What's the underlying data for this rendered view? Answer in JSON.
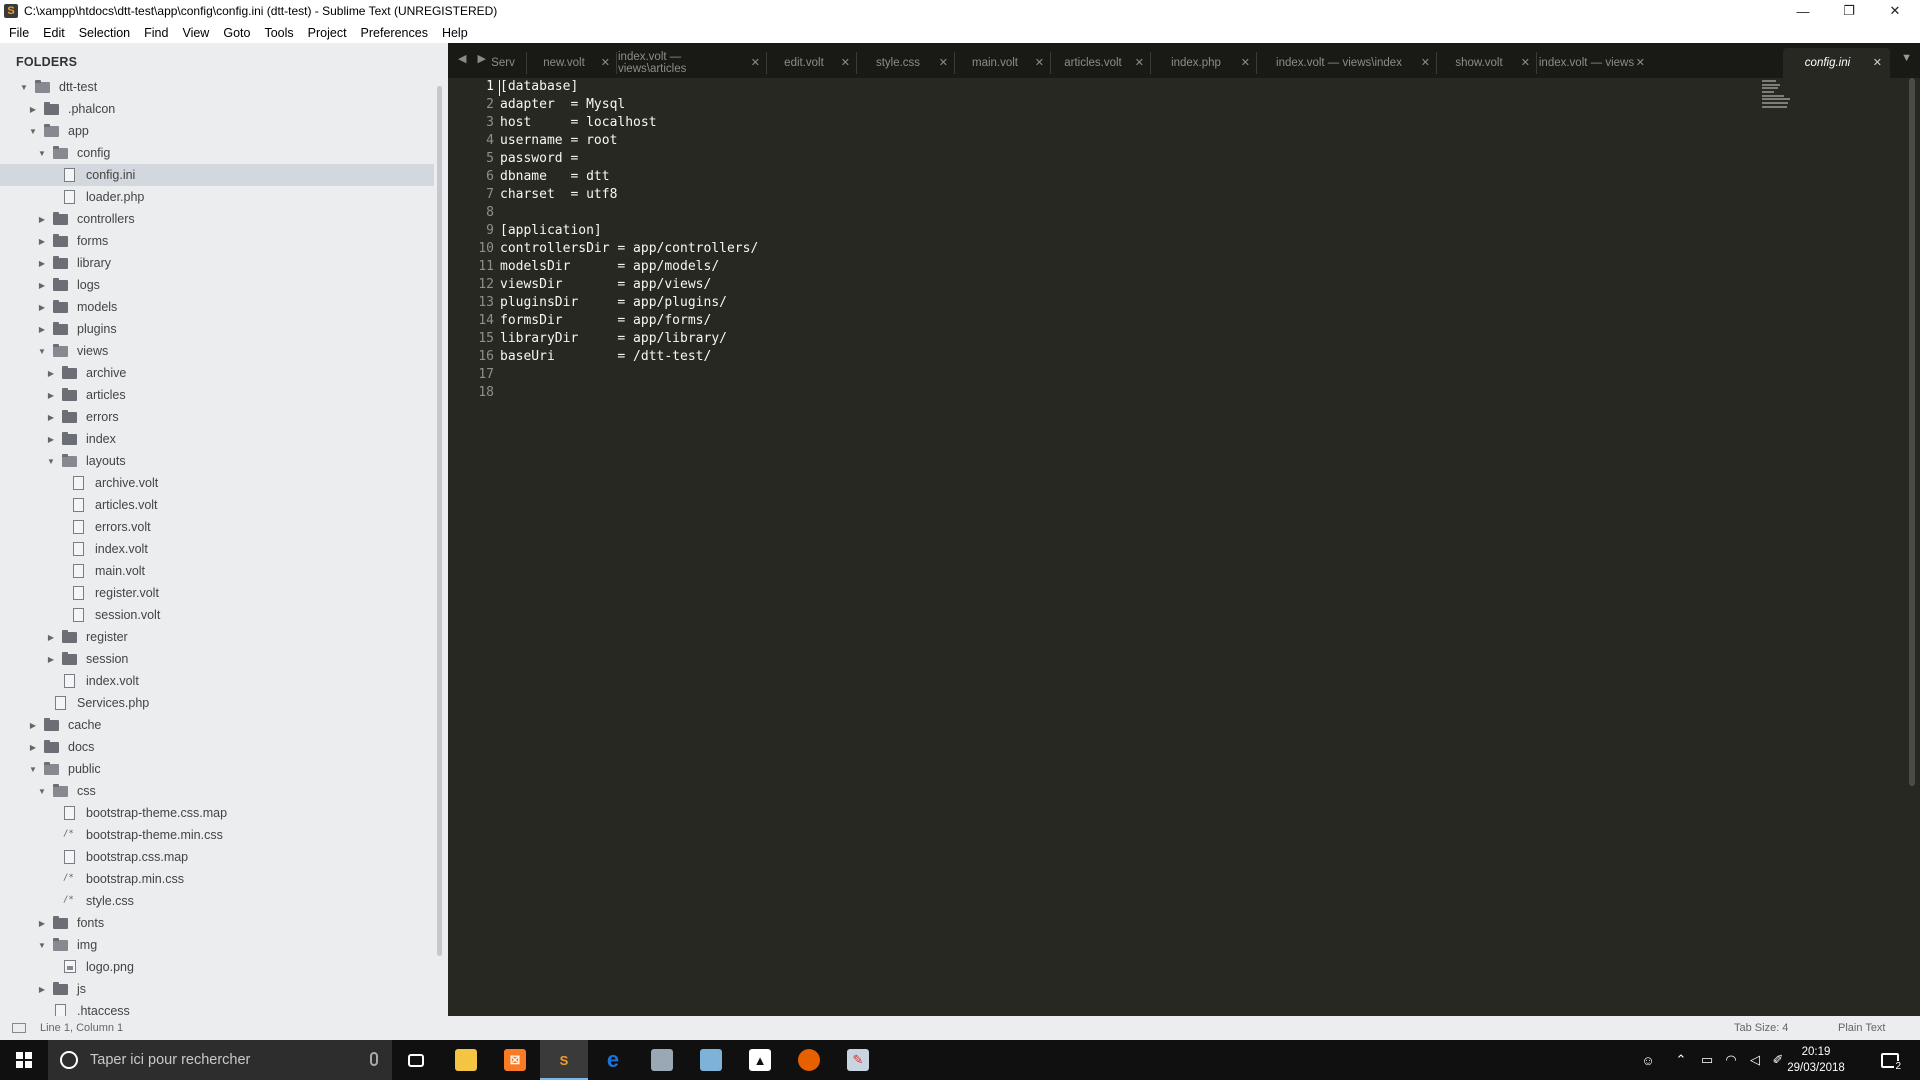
{
  "window": {
    "title": "C:\\xampp\\htdocs\\dtt-test\\app\\config\\config.ini (dtt-test) - Sublime Text (UNREGISTERED)",
    "controls": {
      "minimize": "—",
      "maximize": "❐",
      "close": "✕"
    }
  },
  "menu": [
    "File",
    "Edit",
    "Selection",
    "Find",
    "View",
    "Goto",
    "Tools",
    "Project",
    "Preferences",
    "Help"
  ],
  "sidebar": {
    "title": "FOLDERS",
    "tree": [
      {
        "name": "dtt-test",
        "type": "folder",
        "depth": 0,
        "expanded": true
      },
      {
        "name": ".phalcon",
        "type": "folder",
        "depth": 1,
        "expanded": false
      },
      {
        "name": "app",
        "type": "folder",
        "depth": 1,
        "expanded": true
      },
      {
        "name": "config",
        "type": "folder",
        "depth": 2,
        "expanded": true
      },
      {
        "name": "config.ini",
        "type": "file",
        "depth": 3,
        "selected": true
      },
      {
        "name": "loader.php",
        "type": "file",
        "depth": 3
      },
      {
        "name": "controllers",
        "type": "folder",
        "depth": 2,
        "expanded": false
      },
      {
        "name": "forms",
        "type": "folder",
        "depth": 2,
        "expanded": false
      },
      {
        "name": "library",
        "type": "folder",
        "depth": 2,
        "expanded": false
      },
      {
        "name": "logs",
        "type": "folder",
        "depth": 2,
        "expanded": false
      },
      {
        "name": "models",
        "type": "folder",
        "depth": 2,
        "expanded": false
      },
      {
        "name": "plugins",
        "type": "folder",
        "depth": 2,
        "expanded": false
      },
      {
        "name": "views",
        "type": "folder",
        "depth": 2,
        "expanded": true
      },
      {
        "name": "archive",
        "type": "folder",
        "depth": 3,
        "expanded": false
      },
      {
        "name": "articles",
        "type": "folder",
        "depth": 3,
        "expanded": false
      },
      {
        "name": "errors",
        "type": "folder",
        "depth": 3,
        "expanded": false
      },
      {
        "name": "index",
        "type": "folder",
        "depth": 3,
        "expanded": false
      },
      {
        "name": "layouts",
        "type": "folder",
        "depth": 3,
        "expanded": true
      },
      {
        "name": "archive.volt",
        "type": "file",
        "depth": 4
      },
      {
        "name": "articles.volt",
        "type": "file",
        "depth": 4
      },
      {
        "name": "errors.volt",
        "type": "file",
        "depth": 4
      },
      {
        "name": "index.volt",
        "type": "file",
        "depth": 4
      },
      {
        "name": "main.volt",
        "type": "file",
        "depth": 4
      },
      {
        "name": "register.volt",
        "type": "file",
        "depth": 4
      },
      {
        "name": "session.volt",
        "type": "file",
        "depth": 4
      },
      {
        "name": "register",
        "type": "folder",
        "depth": 3,
        "expanded": false
      },
      {
        "name": "session",
        "type": "folder",
        "depth": 3,
        "expanded": false
      },
      {
        "name": "index.volt",
        "type": "file",
        "depth": 3
      },
      {
        "name": "Services.php",
        "type": "file",
        "depth": 2
      },
      {
        "name": "cache",
        "type": "folder",
        "depth": 1,
        "expanded": false
      },
      {
        "name": "docs",
        "type": "folder",
        "depth": 1,
        "expanded": false
      },
      {
        "name": "public",
        "type": "folder",
        "depth": 1,
        "expanded": true
      },
      {
        "name": "css",
        "type": "folder",
        "depth": 2,
        "expanded": true
      },
      {
        "name": "bootstrap-theme.css.map",
        "type": "file",
        "depth": 3
      },
      {
        "name": "bootstrap-theme.min.css",
        "type": "code",
        "depth": 3
      },
      {
        "name": "bootstrap.css.map",
        "type": "file",
        "depth": 3
      },
      {
        "name": "bootstrap.min.css",
        "type": "code",
        "depth": 3
      },
      {
        "name": "style.css",
        "type": "code",
        "depth": 3
      },
      {
        "name": "fonts",
        "type": "folder",
        "depth": 2,
        "expanded": false
      },
      {
        "name": "img",
        "type": "folder",
        "depth": 2,
        "expanded": true
      },
      {
        "name": "logo.png",
        "type": "image",
        "depth": 3
      },
      {
        "name": "js",
        "type": "folder",
        "depth": 2,
        "expanded": false
      },
      {
        "name": ".htaccess",
        "type": "file",
        "depth": 2
      }
    ]
  },
  "tabs": [
    {
      "label": "Serv",
      "active": false,
      "close": false
    },
    {
      "label": "new.volt",
      "active": false,
      "close": true
    },
    {
      "label": "index.volt — views\\articles",
      "active": false,
      "close": true
    },
    {
      "label": "edit.volt",
      "active": false,
      "close": true
    },
    {
      "label": "style.css",
      "active": false,
      "close": true
    },
    {
      "label": "main.volt",
      "active": false,
      "close": true
    },
    {
      "label": "articles.volt",
      "active": false,
      "close": true
    },
    {
      "label": "index.php",
      "active": false,
      "close": true
    },
    {
      "label": "index.volt — views\\index",
      "active": false,
      "close": true
    },
    {
      "label": "show.volt",
      "active": false,
      "close": true
    },
    {
      "label": "index.volt — views",
      "active": false,
      "close": true
    },
    {
      "label": "config.ini",
      "active": true,
      "close": true
    }
  ],
  "tab_close_glyph": "✕",
  "tab_overflow_glyph": "▼",
  "tab_nav_glyph": "◀ ▶",
  "editor": {
    "current_line": 1,
    "lines": [
      "[database]",
      "adapter  = Mysql",
      "host     = localhost",
      "username = root",
      "password =",
      "dbname   = dtt",
      "charset  = utf8",
      "",
      "[application]",
      "controllersDir = app/controllers/",
      "modelsDir      = app/models/",
      "viewsDir       = app/views/",
      "pluginsDir     = app/plugins/",
      "formsDir       = app/forms/",
      "libraryDir     = app/library/",
      "baseUri        = /dtt-test/",
      "",
      ""
    ]
  },
  "statusbar": {
    "position": "Line 1, Column 1",
    "tab_size": "Tab Size: 4",
    "syntax": "Plain Text"
  },
  "taskbar": {
    "search_placeholder": "Taper ici pour rechercher",
    "time": "20:19",
    "date": "29/03/2018",
    "notification_count": "2",
    "colors": {
      "explorer": "#f4c542",
      "xampp": "#fb7a24",
      "sublime": "#f29d2b",
      "edge": "#1a73d9",
      "firefox": "#e66000"
    }
  }
}
